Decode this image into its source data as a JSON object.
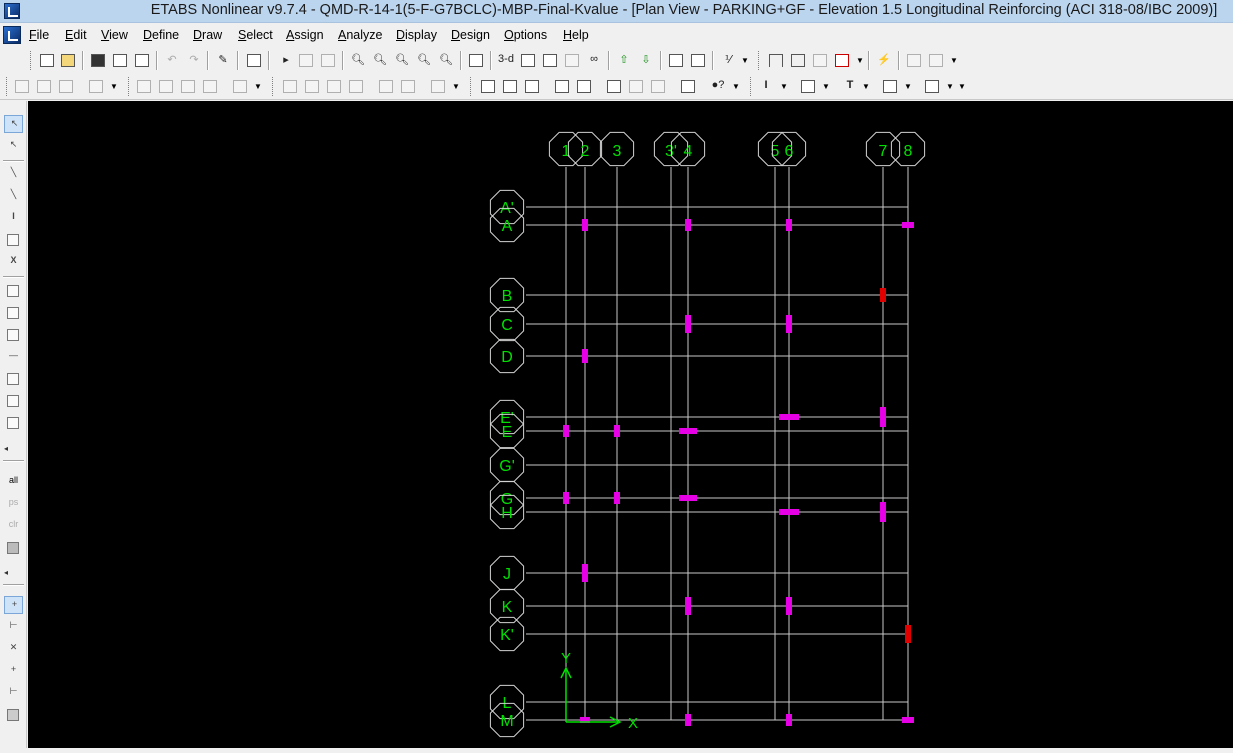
{
  "window": {
    "title": "ETABS Nonlinear v9.7.4 - QMD-R-14-1(5-F-G7BCLC)-MBP-Final-Kvalue - [Plan View - PARKING+GF - Elevation 1.5  Longitudinal Reinforcing  (ACI 318-08/IBC 2009)]"
  },
  "menu": {
    "items": [
      "File",
      "Edit",
      "View",
      "Define",
      "Draw",
      "Select",
      "Assign",
      "Analyze",
      "Display",
      "Design",
      "Options",
      "Help"
    ]
  },
  "toolbar": {
    "view_3d_label": "3-d"
  },
  "sidebar": {
    "all_label": "all",
    "ps_label": "ps",
    "clr_label": "clr"
  },
  "plan": {
    "grid_columns": [
      "1",
      "2",
      "3",
      "3'",
      "4",
      "5",
      "6",
      "7",
      "8"
    ],
    "grid_rows": [
      "A'",
      "A",
      "B",
      "C",
      "D",
      "E'",
      "E",
      "G'",
      "G",
      "H",
      "J",
      "K",
      "K'",
      "L",
      "M"
    ],
    "axis_x_label": "X",
    "axis_y_label": "Y",
    "colors": {
      "background": "#000000",
      "grid_line": "#c8c8c8",
      "bubble_outline": "#d2d2d2",
      "label": "#00e000",
      "column_ok": "#e600e6",
      "column_fail": "#e00000",
      "axis": "#00e000"
    }
  }
}
